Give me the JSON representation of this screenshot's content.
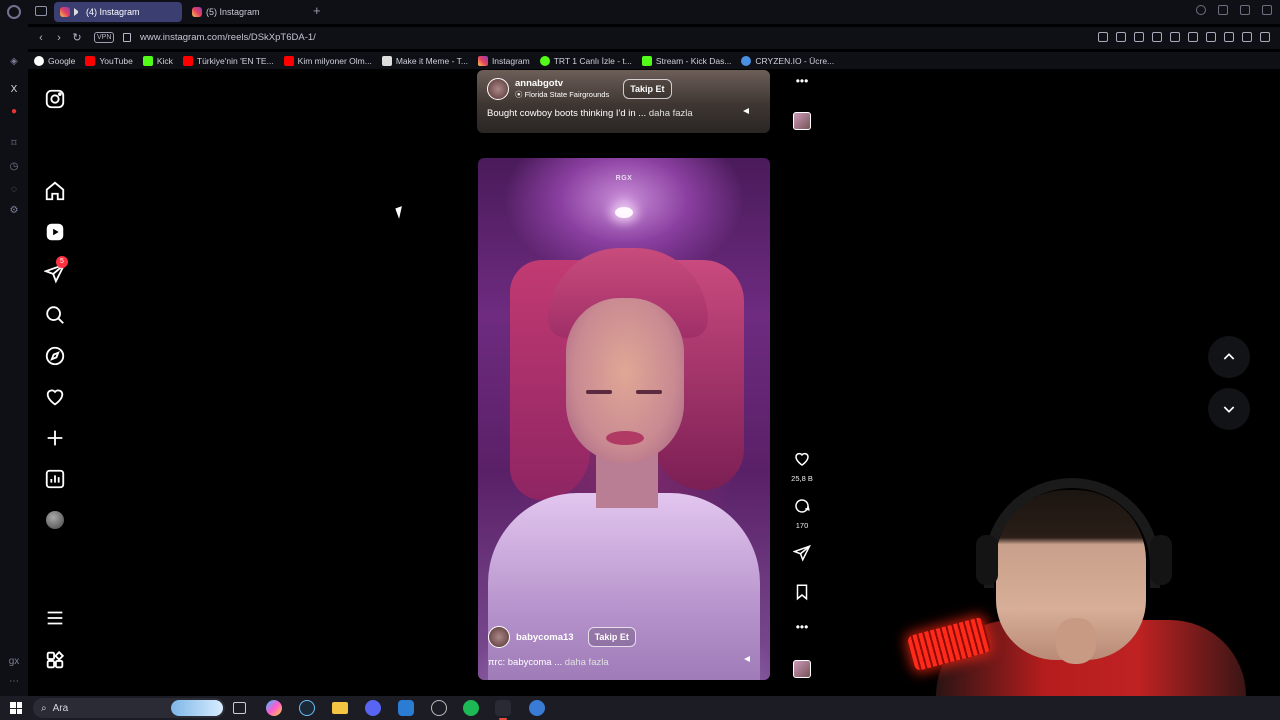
{
  "browser": {
    "tabs": [
      {
        "label": "(4) Instagram",
        "active": true
      },
      {
        "label": "(5) Instagram",
        "active": false
      }
    ],
    "new_tab": "+",
    "url": "www.instagram.com/reels/DSkXpT6DA-1/",
    "vpn_label": "VPN",
    "bookmarks": [
      {
        "label": "Google",
        "color": "#4285f4"
      },
      {
        "label": "YouTube",
        "color": "#ff0000"
      },
      {
        "label": "Kick",
        "color": "#53fc18"
      },
      {
        "label": "Türkiye'nin 'EN TE...",
        "color": "#ff0000"
      },
      {
        "label": "Kim milyoner Olm...",
        "color": "#ff0000"
      },
      {
        "label": "Make it Meme - T...",
        "color": "#ffffff"
      },
      {
        "label": "Instagram",
        "color": "#e4405f"
      },
      {
        "label": "TRT 1 Canlı İzle - t...",
        "color": "#53fc18"
      },
      {
        "label": "Stream - Kick Das...",
        "color": "#53fc18"
      },
      {
        "label": "CRYZEN.IO - Ücre...",
        "color": "#4a90e2"
      }
    ]
  },
  "instagram": {
    "nav": [
      {
        "name": "instagram-logo-icon"
      },
      {
        "name": "home-icon"
      },
      {
        "name": "reels-icon"
      },
      {
        "name": "messages-icon",
        "badge": "5"
      },
      {
        "name": "search-icon"
      },
      {
        "name": "explore-icon"
      },
      {
        "name": "notifications-icon"
      },
      {
        "name": "create-icon"
      },
      {
        "name": "dashboard-icon"
      },
      {
        "name": "profile-avatar"
      },
      {
        "name": "menu-icon"
      },
      {
        "name": "also-from-meta-icon"
      }
    ],
    "previous_reel": {
      "username": "annabgotv",
      "location": "Florida State Fairgrounds",
      "follow_label": "Takip Et",
      "caption": "Bought cowboy boots thinking I'd in ...",
      "more_label": "daha fazla"
    },
    "current_reel": {
      "badge": "RGX",
      "username": "babycoma13",
      "follow_label": "Takip Et",
      "caption": "πrc: babycoma ...",
      "more_label": "daha fazla",
      "likes": "25,8 B",
      "comments": "170"
    }
  },
  "taskbar": {
    "search_placeholder": "Ara"
  },
  "colors": {
    "accent": "#3b3e71",
    "notification": "#ff3040",
    "page_background": "#000000"
  }
}
